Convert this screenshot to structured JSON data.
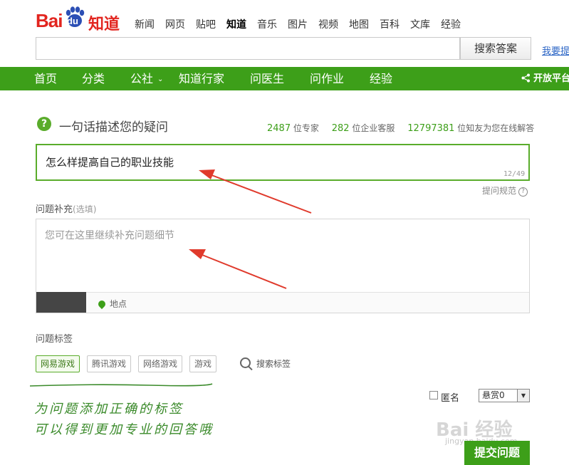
{
  "logo": {
    "bai": "Bai",
    "du": "du",
    "zhidao": "知道"
  },
  "top_nav": [
    {
      "label": "新闻",
      "active": false
    },
    {
      "label": "网页",
      "active": false
    },
    {
      "label": "贴吧",
      "active": false
    },
    {
      "label": "知道",
      "active": true
    },
    {
      "label": "音乐",
      "active": false
    },
    {
      "label": "图片",
      "active": false
    },
    {
      "label": "视频",
      "active": false
    },
    {
      "label": "地图",
      "active": false
    },
    {
      "label": "百科",
      "active": false
    },
    {
      "label": "文库",
      "active": false
    },
    {
      "label": "经验",
      "active": false
    }
  ],
  "search": {
    "value": "",
    "button_label": "搜索答案",
    "ask_link": "我要提问"
  },
  "green_nav": {
    "items": [
      "首页",
      "分类",
      "公社",
      "知道行家",
      "问医生",
      "问作业",
      "经验"
    ],
    "caret": "⌄",
    "open_platform": "开放平台"
  },
  "question": {
    "title": "一句话描述您的疑问",
    "stats": {
      "experts_num": "2487",
      "experts_label": "位专家",
      "enterprise_num": "282",
      "enterprise_label": "位企业客服",
      "online_num": "12797381",
      "online_label": "位知友为您在线解答"
    },
    "value": "怎么样提高自己的职业技能",
    "char_count": "12/49",
    "rules_label": "提问规范"
  },
  "supplement": {
    "label": "问题补充",
    "optional": "(选填)",
    "placeholder": "您可在这里继续补充问题细节",
    "location_label": "地点"
  },
  "tags": {
    "label": "问题标签",
    "items": [
      {
        "label": "网易游戏",
        "selected": true
      },
      {
        "label": "腾讯游戏",
        "selected": false
      },
      {
        "label": "网络游戏",
        "selected": false
      },
      {
        "label": "游戏",
        "selected": false
      }
    ],
    "search_label": "搜索标签"
  },
  "footer": {
    "anonymous_label": "匿名",
    "reward_value": "悬赏0",
    "submit_label": "提交问题"
  },
  "annotation": {
    "line1": "为问题添加正确的标签",
    "line2": "可以得到更加专业的回答哦"
  },
  "watermark": {
    "text": "Bai 经验",
    "url": "jingyan.baidu.com"
  },
  "colors": {
    "brand_red": "#e2251f",
    "brand_green": "#3d9f19",
    "accent_green": "#5aac2b",
    "arrow_red": "#e03a2c",
    "link_blue": "#2a64c5"
  }
}
